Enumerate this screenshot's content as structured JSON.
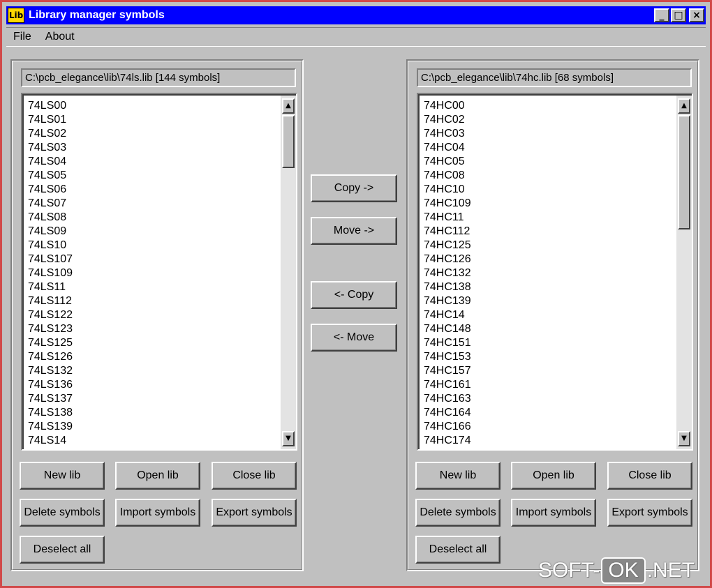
{
  "window": {
    "title": "Library manager symbols",
    "icon_label": "Lib",
    "controls": {
      "minimize": "_",
      "maximize": "□",
      "close": "×"
    }
  },
  "menu": {
    "items": [
      "File",
      "About"
    ]
  },
  "left_panel": {
    "path": "C:\\pcb_elegance\\lib\\74ls.lib [144 symbols]",
    "items": [
      "74LS00",
      "74LS01",
      "74LS02",
      "74LS03",
      "74LS04",
      "74LS05",
      "74LS06",
      "74LS07",
      "74LS08",
      "74LS09",
      "74LS10",
      "74LS107",
      "74LS109",
      "74LS11",
      "74LS112",
      "74LS122",
      "74LS123",
      "74LS125",
      "74LS126",
      "74LS132",
      "74LS136",
      "74LS137",
      "74LS138",
      "74LS139",
      "74LS14"
    ],
    "scroll_position": 0.0,
    "buttons": {
      "new_lib": "New lib",
      "open_lib": "Open lib",
      "close_lib": "Close lib",
      "delete_symbols": "Delete symbols",
      "import_symbols": "Import symbols",
      "export_symbols": "Export symbols",
      "deselect_all": "Deselect all"
    }
  },
  "right_panel": {
    "path": "C:\\pcb_elegance\\lib\\74hc.lib [68 symbols]",
    "items": [
      "74HC00",
      "74HC02",
      "74HC03",
      "74HC04",
      "74HC05",
      "74HC08",
      "74HC10",
      "74HC109",
      "74HC11",
      "74HC112",
      "74HC125",
      "74HC126",
      "74HC132",
      "74HC138",
      "74HC139",
      "74HC14",
      "74HC148",
      "74HC151",
      "74HC153",
      "74HC157",
      "74HC161",
      "74HC163",
      "74HC164",
      "74HC166",
      "74HC174"
    ],
    "scroll_position": 0.0,
    "buttons": {
      "new_lib": "New lib",
      "open_lib": "Open lib",
      "close_lib": "Close lib",
      "delete_symbols": "Delete symbols",
      "import_symbols": "Import symbols",
      "export_symbols": "Export symbols",
      "deselect_all": "Deselect all"
    }
  },
  "center_buttons": {
    "copy_right": "Copy ->",
    "move_right": "Move ->",
    "copy_left": "<- Copy",
    "move_left": "<- Move"
  },
  "watermark": {
    "before": "SOFT-",
    "ok": "OK",
    "after": ".NET"
  },
  "colors": {
    "titlebar": "#0000ff",
    "face": "#c0c0c0",
    "window_border": "#d14a4a",
    "icon_bg": "#ffd800"
  }
}
